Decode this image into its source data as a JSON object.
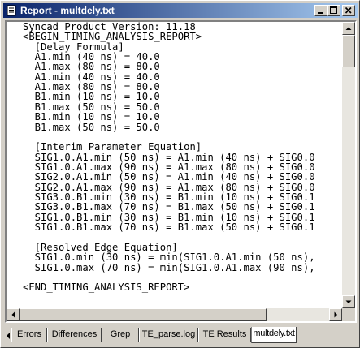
{
  "window": {
    "title": "Report - multdely.txt",
    "icon": "report-document-icon",
    "controls": [
      "minimize-icon",
      "maximize-icon",
      "close-icon"
    ]
  },
  "editor": {
    "lines": [
      "Syncad Product Version: 11.18",
      "<BEGIN_TIMING_ANALYSIS_REPORT>",
      "  [Delay Formula]",
      "  A1.min (40 ns) = 40.0",
      "  A1.max (80 ns) = 80.0",
      "  A1.min (40 ns) = 40.0",
      "  A1.max (80 ns) = 80.0",
      "  B1.min (10 ns) = 10.0",
      "  B1.max (50 ns) = 50.0",
      "  B1.min (10 ns) = 10.0",
      "  B1.max (50 ns) = 50.0",
      "",
      "  [Interim Parameter Equation]",
      "  SIG1.0.A1.min (50 ns) = A1.min (40 ns) + SIG0.0",
      "  SIG1.0.A1.max (90 ns) = A1.max (80 ns) + SIG0.0",
      "  SIG2.0.A1.min (50 ns) = A1.min (40 ns) + SIG0.0",
      "  SIG2.0.A1.max (90 ns) = A1.max (80 ns) + SIG0.0",
      "  SIG3.0.B1.min (30 ns) = B1.min (10 ns) + SIG0.1",
      "  SIG3.0.B1.max (70 ns) = B1.max (50 ns) + SIG0.1",
      "  SIG1.0.B1.min (30 ns) = B1.min (10 ns) + SIG0.1",
      "  SIG1.0.B1.max (70 ns) = B1.max (50 ns) + SIG0.1",
      "",
      "  [Resolved Edge Equation]",
      "  SIG1.0.min (30 ns) = min(SIG1.0.A1.min (50 ns),",
      "  SIG1.0.max (70 ns) = min(SIG1.0.A1.max (90 ns),",
      "",
      "<END_TIMING_ANALYSIS_REPORT>"
    ]
  },
  "tabs": [
    {
      "label": "Errors",
      "active": false
    },
    {
      "label": "Differences",
      "active": false
    },
    {
      "label": "Grep",
      "active": false
    },
    {
      "label": "TE_parse.log",
      "active": false
    },
    {
      "label": "TE Results",
      "active": false
    },
    {
      "label": "multdely.txt",
      "active": true
    }
  ],
  "colors": {
    "title_gradient_start": "#0a246a",
    "title_gradient_end": "#a6caf0",
    "chrome": "#d4d0c8",
    "editor_bg": "#ffffff"
  }
}
